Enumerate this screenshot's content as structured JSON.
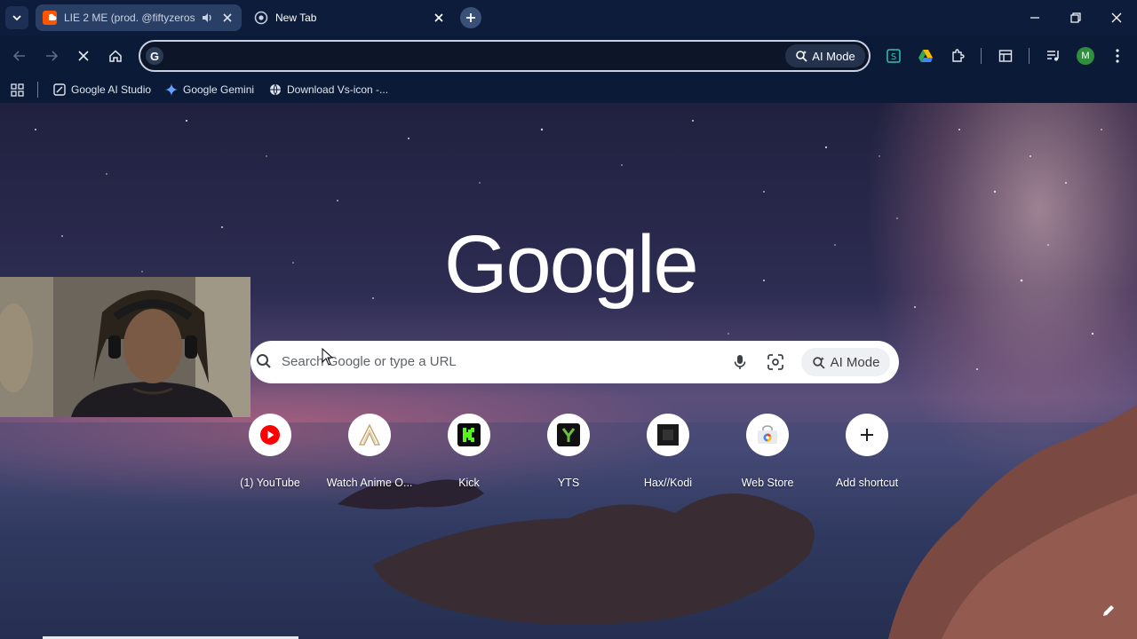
{
  "tabs": [
    {
      "title": "LIE 2 ME (prod. @fiftyzeros",
      "favicon": "soundcloud-icon",
      "playing_audio": true,
      "active": false
    },
    {
      "title": "New Tab",
      "favicon": "chrome-icon",
      "playing_audio": false,
      "active": true
    }
  ],
  "omnibox": {
    "value": "",
    "ai_mode_label": "AI Mode"
  },
  "bookmarks": [
    {
      "label": "Google AI Studio",
      "icon": "ai-studio-icon"
    },
    {
      "label": "Google Gemini",
      "icon": "gemini-icon"
    },
    {
      "label": "Download Vs-icon -...",
      "icon": "globe-icon"
    }
  ],
  "ntp": {
    "logo_text": "Google",
    "search_placeholder": "Search Google or type a URL",
    "ai_mode_label": "AI Mode",
    "shortcuts": [
      {
        "label": "(1) YouTube",
        "icon": "youtube-icon"
      },
      {
        "label": "Watch Anime O...",
        "icon": "anime-icon"
      },
      {
        "label": "Kick",
        "icon": "kick-icon"
      },
      {
        "label": "YTS",
        "icon": "yts-icon"
      },
      {
        "label": "Hax//Kodi",
        "icon": "hax-icon"
      },
      {
        "label": "Web Store",
        "icon": "webstore-icon"
      },
      {
        "label": "Add shortcut",
        "icon": "plus-icon"
      }
    ]
  },
  "profile": {
    "initial": "M",
    "color": "#2f8f3f"
  }
}
